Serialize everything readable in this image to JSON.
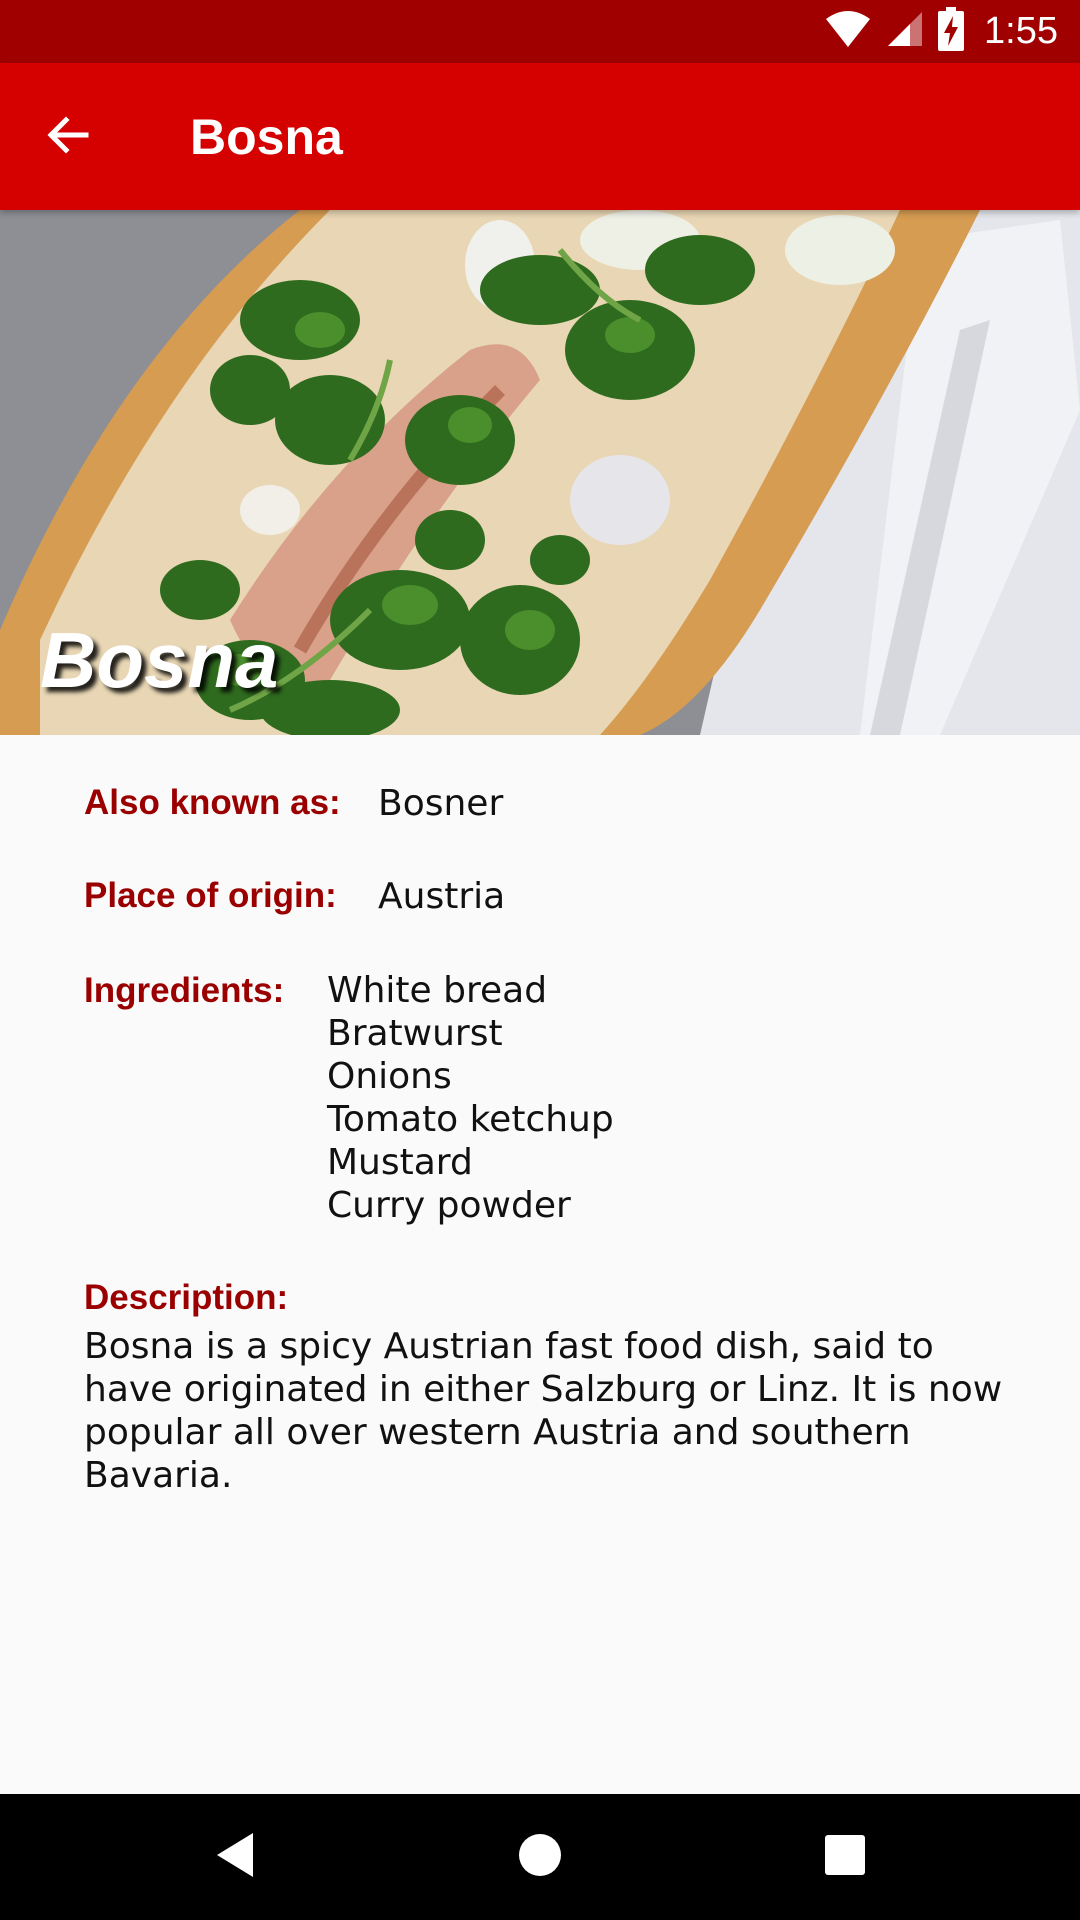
{
  "status_bar": {
    "time": "1:55",
    "icons": [
      "wifi-icon",
      "cellular-signal-icon",
      "battery-charging-icon"
    ]
  },
  "app_bar": {
    "back_icon": "arrow-back-icon",
    "title": "Bosna"
  },
  "hero": {
    "caption": "Bosna"
  },
  "details": {
    "also_known_as_label": "Also known as:",
    "also_known_as_value": "Bosner",
    "place_of_origin_label": "Place of origin:",
    "place_of_origin_value": "Austria",
    "ingredients_label": "Ingredients:",
    "ingredients": [
      "White bread",
      "Bratwurst",
      "Onions",
      "Tomato ketchup",
      "Mustard",
      "Curry powder"
    ],
    "description_label": "Description:",
    "description": "Bosna is a spicy Austrian fast food dish, said to have originated in either Salzburg or Linz. It is now popular all over western Austria and southern Bavaria."
  },
  "nav_bar": {
    "icons": [
      "nav-back-icon",
      "nav-home-icon",
      "nav-recents-icon"
    ]
  },
  "colors": {
    "status_bar": "#a00000",
    "app_bar": "#d50000",
    "label": "#9b0000",
    "background": "#fafafa"
  }
}
